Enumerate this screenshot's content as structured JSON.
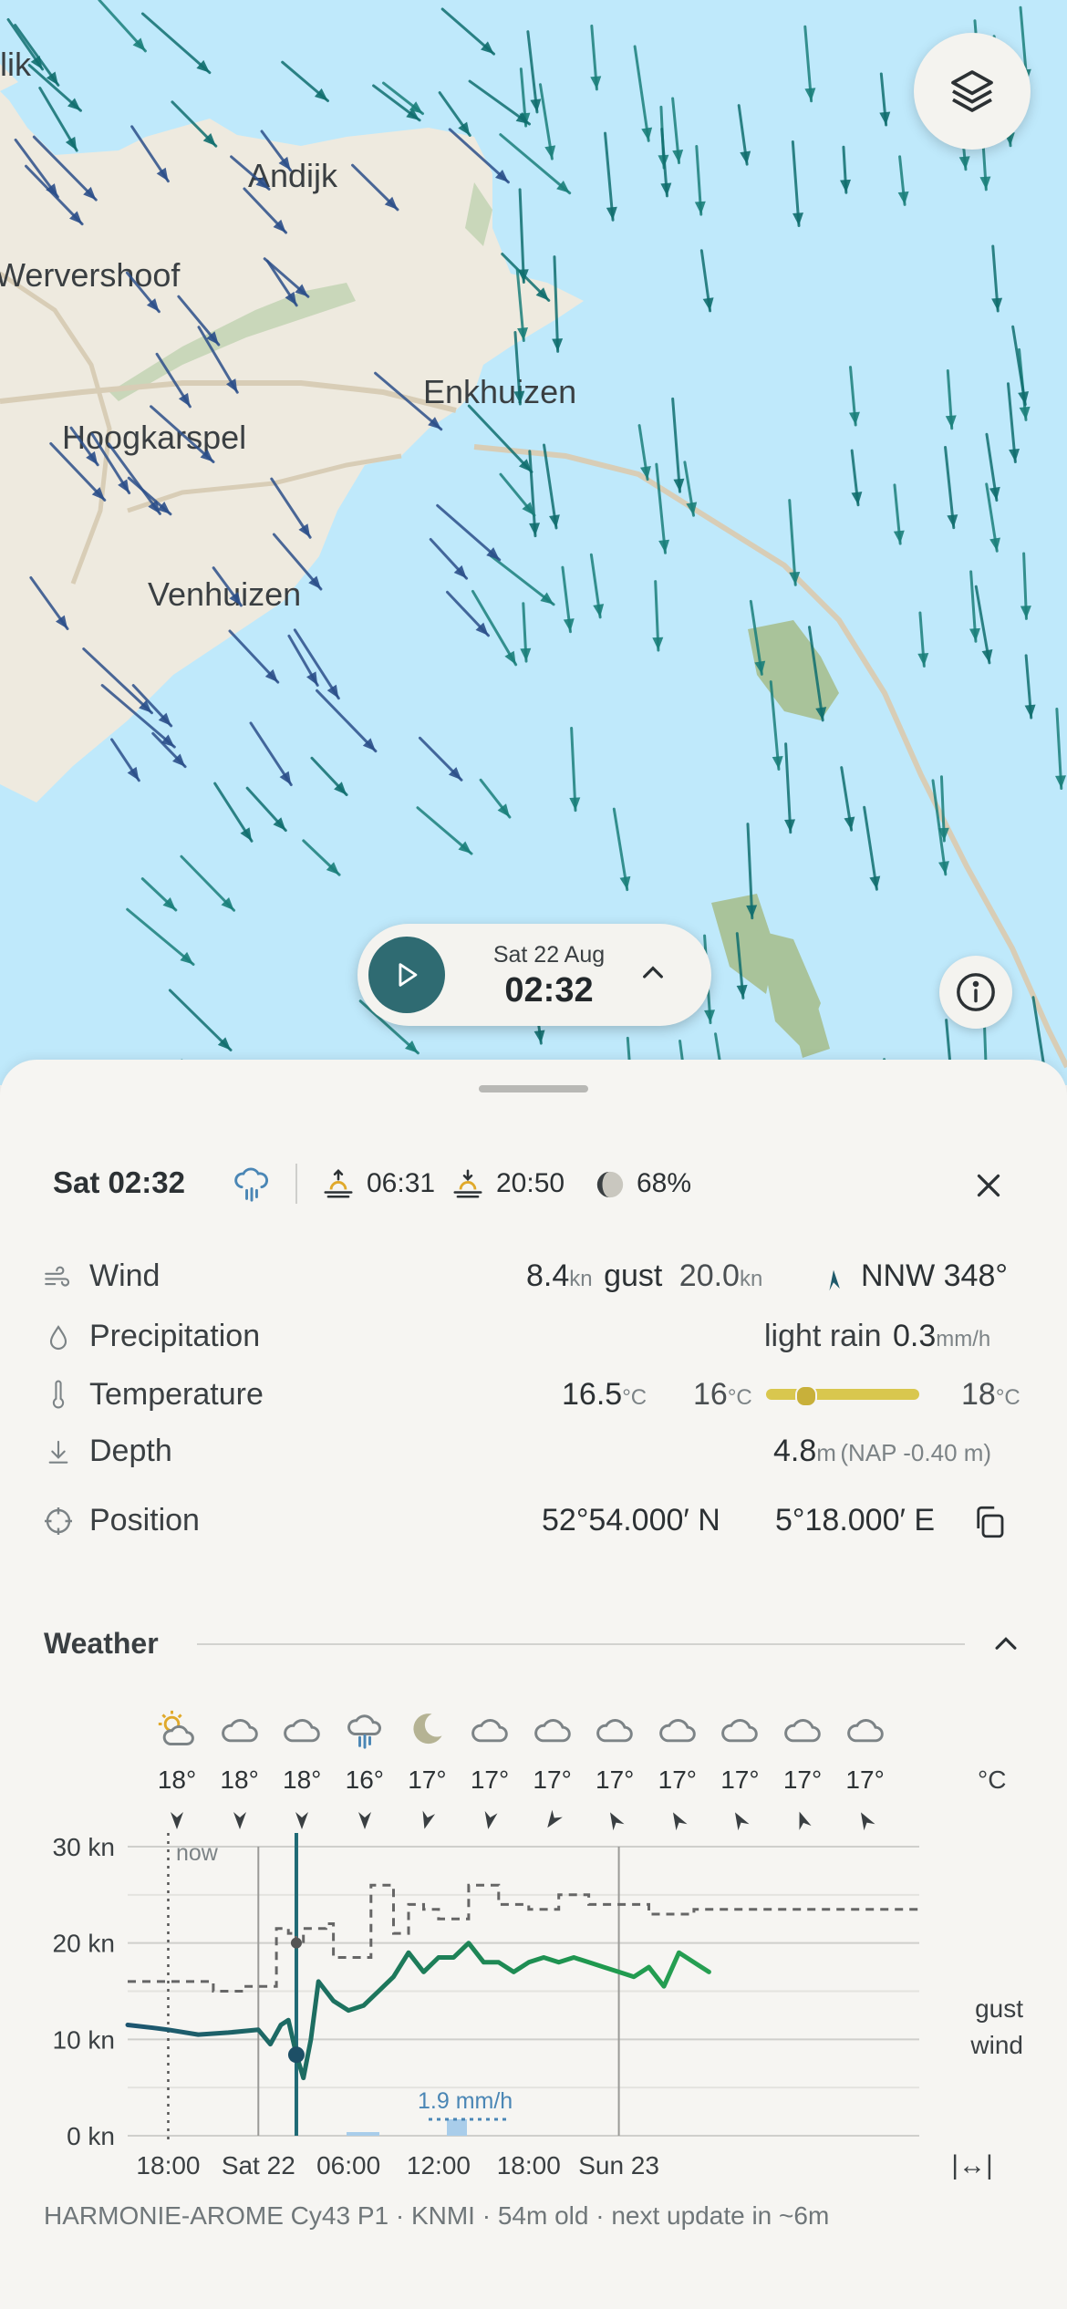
{
  "map": {
    "places": [
      "Andijk",
      "Wervershoof",
      "Enkhuizen",
      "Hoogkarspel",
      "Venhuizen",
      "lik"
    ],
    "player": {
      "date": "Sat 22 Aug",
      "time": "02:32"
    },
    "icons": [
      "layers-icon",
      "play-icon",
      "chevron-up-icon",
      "info-icon"
    ]
  },
  "header": {
    "time": "Sat 02:32",
    "sunrise": "06:31",
    "sunset": "20:50",
    "moon": "68%"
  },
  "details": {
    "wind": {
      "label": "Wind",
      "speed": "8.4",
      "speed_unit": "kn",
      "gust_label": "gust",
      "gust": "20.0",
      "gust_unit": "kn",
      "direction": "NNW 348°"
    },
    "precipitation": {
      "label": "Precipitation",
      "desc": "light rain",
      "value": "0.3",
      "unit": "mm/h"
    },
    "temperature": {
      "label": "Temperature",
      "value": "16.5",
      "unit": "°C",
      "min": "16",
      "max": "18",
      "range_position": 0.25
    },
    "depth": {
      "label": "Depth",
      "value": "4.8",
      "unit": "m",
      "note": "(NAP -0.40 m)"
    },
    "position": {
      "label": "Position",
      "lat": "52°54.000′ N",
      "lon": "5°18.000′ E"
    }
  },
  "weather": {
    "title": "Weather",
    "temp_unit": "°C",
    "now_label": "now",
    "rain_label": "1.9 mm/h",
    "gust_legend": "gust",
    "wind_legend": "wind",
    "expand_symbol": "|↔|",
    "footer": "HARMONIE-AROME Cy43 P1 · KNMI · 54m old · next update in ~6m",
    "columns": [
      {
        "icon": "partly-sunny-icon",
        "temp": "18°",
        "dir_deg": 0
      },
      {
        "icon": "cloud-icon",
        "temp": "18°",
        "dir_deg": 0
      },
      {
        "icon": "cloud-icon",
        "temp": "18°",
        "dir_deg": 0
      },
      {
        "icon": "rain-icon",
        "temp": "16°",
        "dir_deg": 0
      },
      {
        "icon": "moon-icon",
        "temp": "17°",
        "dir_deg": 15
      },
      {
        "icon": "cloud-icon",
        "temp": "17°",
        "dir_deg": 10
      },
      {
        "icon": "cloud-icon",
        "temp": "17°",
        "dir_deg": 35
      },
      {
        "icon": "cloud-icon",
        "temp": "17°",
        "dir_deg": 150
      },
      {
        "icon": "cloud-icon",
        "temp": "17°",
        "dir_deg": 150
      },
      {
        "icon": "cloud-icon",
        "temp": "17°",
        "dir_deg": 150
      },
      {
        "icon": "cloud-icon",
        "temp": "17°",
        "dir_deg": 160
      },
      {
        "icon": "cloud-icon",
        "temp": "17°",
        "dir_deg": 150
      }
    ]
  },
  "chart_data": {
    "type": "line",
    "ylabel": "",
    "ylim": [
      0,
      30
    ],
    "y_ticks": [
      "0 kn",
      "10 kn",
      "20 kn",
      "30 kn"
    ],
    "x_ticks": [
      "18:00",
      "Sat 22",
      "06:00",
      "12:00",
      "18:00",
      "Sun 23"
    ],
    "x_range_hours": [
      -8.7,
      44.0
    ],
    "x_tick_hours": [
      -6,
      0,
      6,
      12,
      18,
      24
    ],
    "now_hour": -6,
    "cursor_hour": 2.53,
    "series": [
      {
        "name": "gust",
        "style": "dashed",
        "color": "#666666",
        "x": [
          -8.7,
          -6,
          -3,
          -1,
          0,
          1.2,
          2,
          2.5,
          3,
          4.5,
          5,
          7,
          7.5,
          9,
          10,
          11,
          12,
          14,
          16,
          18,
          20,
          22,
          24,
          26,
          28,
          29,
          30
        ],
        "y": [
          16,
          16,
          15,
          15.5,
          15.5,
          21.5,
          21,
          20,
          21.5,
          22,
          18.5,
          18.5,
          26,
          21,
          24,
          23.5,
          22.5,
          26,
          24,
          23.5,
          25,
          24,
          24,
          23,
          23,
          23.5,
          23.5
        ]
      },
      {
        "name": "wind",
        "style": "solid",
        "color": "#1f8f4e",
        "x": [
          -8.7,
          -7,
          -6,
          -4,
          -2,
          0,
          0.8,
          1.5,
          2,
          2.53,
          3,
          3.5,
          4,
          5,
          6,
          7,
          8,
          9,
          10,
          11,
          12,
          13,
          14,
          15,
          16,
          17,
          18,
          19,
          20,
          21,
          22,
          23,
          24,
          25,
          26,
          27,
          28,
          29,
          30
        ],
        "y": [
          11.5,
          11.2,
          11,
          10.5,
          10.7,
          11,
          9.5,
          11.5,
          12,
          8.4,
          6,
          10,
          16,
          14,
          13,
          13.5,
          15,
          16.5,
          19,
          17,
          18.5,
          18.5,
          20,
          18,
          18,
          17,
          18,
          18.5,
          18,
          18.5,
          18,
          17.5,
          17,
          16.5,
          17.5,
          15.5,
          19,
          18,
          17
        ]
      }
    ]
  }
}
